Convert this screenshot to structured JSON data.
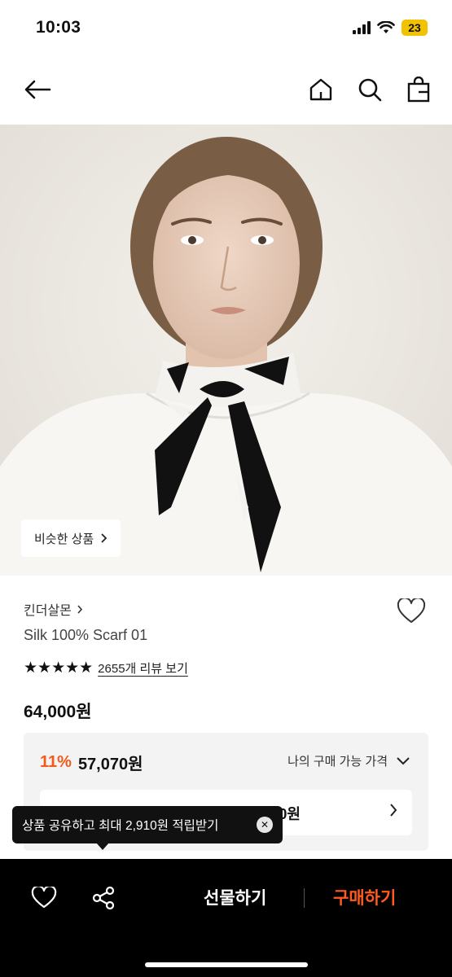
{
  "status": {
    "time": "10:03",
    "battery": "23"
  },
  "nav": {
    "back_icon": "arrow-left-icon",
    "home_icon": "home-icon",
    "search_icon": "search-icon",
    "bag_icon": "shopping-bag-icon"
  },
  "hero": {
    "similar_label": "비슷한 상품"
  },
  "product": {
    "brand": "킨더살몬",
    "name": "Silk 100% Scarf 01",
    "stars": "★★★★★",
    "review_link": "2655개 리뷰 보기",
    "price": "64,000원"
  },
  "price_box": {
    "discount": "11%",
    "discount_price": "57,070원",
    "my_price_label": "나의 구매 가능 가격",
    "coupon_partial": "0원"
  },
  "tooltip": {
    "text": "상품 공유하고 최대 2,910원 적립받기"
  },
  "bottom_bar": {
    "gift_label": "선물하기",
    "buy_label": "구매하기"
  },
  "colors": {
    "accent": "#ff5a1f",
    "discount": "#f25a1c",
    "bottom_bg": "#000000",
    "box_bg": "#f3f3f4"
  }
}
